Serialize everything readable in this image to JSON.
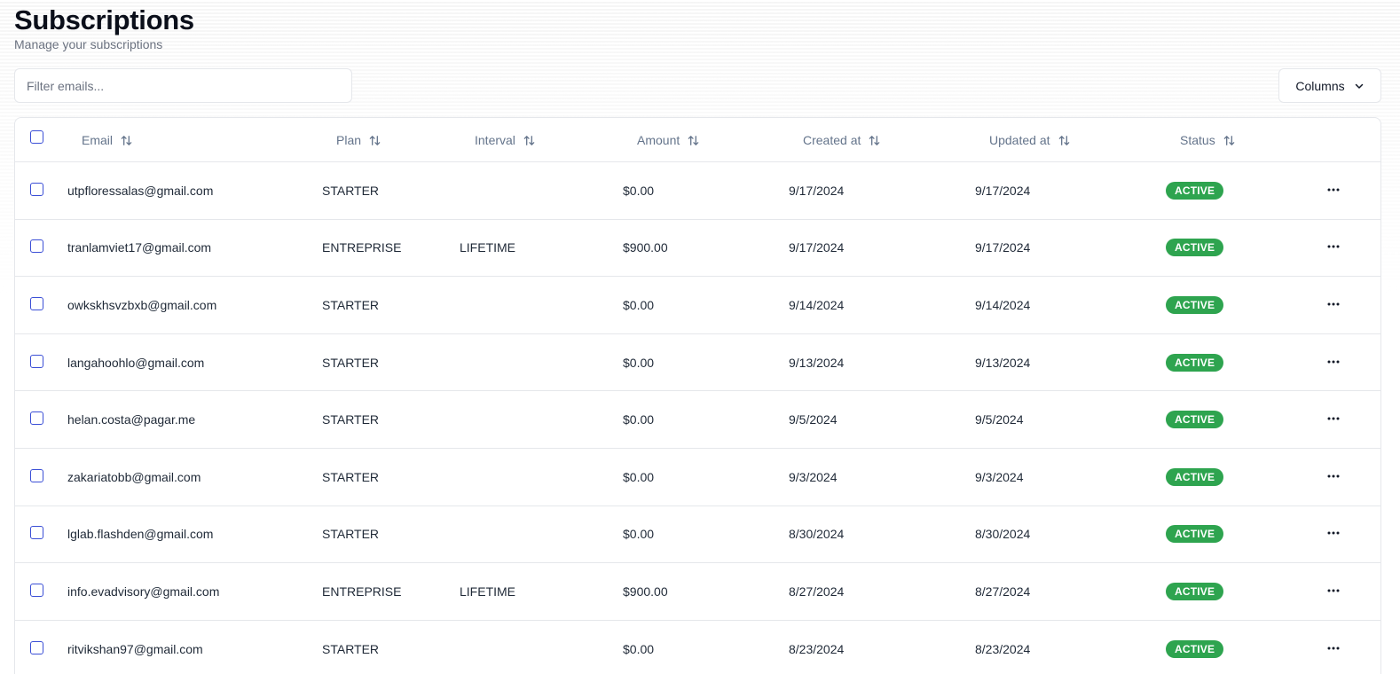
{
  "header": {
    "title": "Subscriptions",
    "subtitle": "Manage your subscriptions"
  },
  "filter": {
    "placeholder": "Filter emails..."
  },
  "columns_button": {
    "label": "Columns"
  },
  "table": {
    "columns": [
      "Email",
      "Plan",
      "Interval",
      "Amount",
      "Created at",
      "Updated at",
      "Status"
    ],
    "rows": [
      {
        "email": "utpfloressalas@gmail.com",
        "plan": "STARTER",
        "interval": "",
        "amount": "$0.00",
        "created": "9/17/2024",
        "updated": "9/17/2024",
        "status": "ACTIVE"
      },
      {
        "email": "tranlamviet17@gmail.com",
        "plan": "ENTREPRISE",
        "interval": "LIFETIME",
        "amount": "$900.00",
        "created": "9/17/2024",
        "updated": "9/17/2024",
        "status": "ACTIVE"
      },
      {
        "email": "owkskhsvzbxb@gmail.com",
        "plan": "STARTER",
        "interval": "",
        "amount": "$0.00",
        "created": "9/14/2024",
        "updated": "9/14/2024",
        "status": "ACTIVE"
      },
      {
        "email": "langahoohlo@gmail.com",
        "plan": "STARTER",
        "interval": "",
        "amount": "$0.00",
        "created": "9/13/2024",
        "updated": "9/13/2024",
        "status": "ACTIVE"
      },
      {
        "email": "helan.costa@pagar.me",
        "plan": "STARTER",
        "interval": "",
        "amount": "$0.00",
        "created": "9/5/2024",
        "updated": "9/5/2024",
        "status": "ACTIVE"
      },
      {
        "email": "zakariatobb@gmail.com",
        "plan": "STARTER",
        "interval": "",
        "amount": "$0.00",
        "created": "9/3/2024",
        "updated": "9/3/2024",
        "status": "ACTIVE"
      },
      {
        "email": "lglab.flashden@gmail.com",
        "plan": "STARTER",
        "interval": "",
        "amount": "$0.00",
        "created": "8/30/2024",
        "updated": "8/30/2024",
        "status": "ACTIVE"
      },
      {
        "email": "info.evadvisory@gmail.com",
        "plan": "ENTREPRISE",
        "interval": "LIFETIME",
        "amount": "$900.00",
        "created": "8/27/2024",
        "updated": "8/27/2024",
        "status": "ACTIVE"
      },
      {
        "email": "ritvikshan97@gmail.com",
        "plan": "STARTER",
        "interval": "",
        "amount": "$0.00",
        "created": "8/23/2024",
        "updated": "8/23/2024",
        "status": "ACTIVE"
      }
    ]
  },
  "colors": {
    "status_active": "#2ea44f",
    "checkbox_border": "#3b4fd6",
    "header_text": "#64748b"
  },
  "icons": {
    "sort": "sort-arrows-icon",
    "chevron": "chevron-down-icon",
    "row_menu": "more-horizontal-icon"
  }
}
